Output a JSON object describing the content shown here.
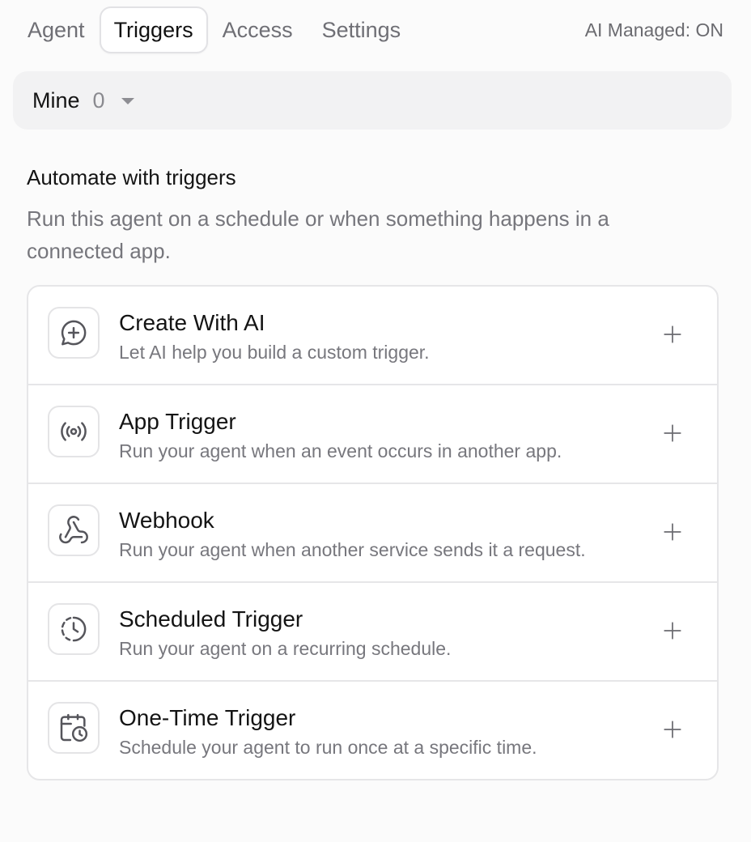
{
  "tabs": [
    {
      "label": "Agent",
      "active": false
    },
    {
      "label": "Triggers",
      "active": true
    },
    {
      "label": "Access",
      "active": false
    },
    {
      "label": "Settings",
      "active": false
    }
  ],
  "ai_status": "AI Managed: ON",
  "filter": {
    "label": "Mine",
    "count": "0"
  },
  "section": {
    "title": "Automate with triggers",
    "description": "Run this agent on a schedule or when something happens in a connected app."
  },
  "triggers": [
    {
      "icon": "chat-plus-icon",
      "title": "Create With AI",
      "description": "Let AI help you build a custom trigger."
    },
    {
      "icon": "broadcast-icon",
      "title": "App Trigger",
      "description": "Run your agent when an event occurs in another app."
    },
    {
      "icon": "webhook-icon",
      "title": "Webhook",
      "description": "Run your agent when another service sends it a request."
    },
    {
      "icon": "clock-dashed-icon",
      "title": "Scheduled Trigger",
      "description": "Run your agent on a recurring schedule."
    },
    {
      "icon": "calendar-clock-icon",
      "title": "One-Time Trigger",
      "description": "Schedule your agent to run once at a specific time."
    }
  ],
  "colors": {
    "accent_text": "#141414",
    "muted_text": "#76767c",
    "border": "#e6e6e8"
  }
}
